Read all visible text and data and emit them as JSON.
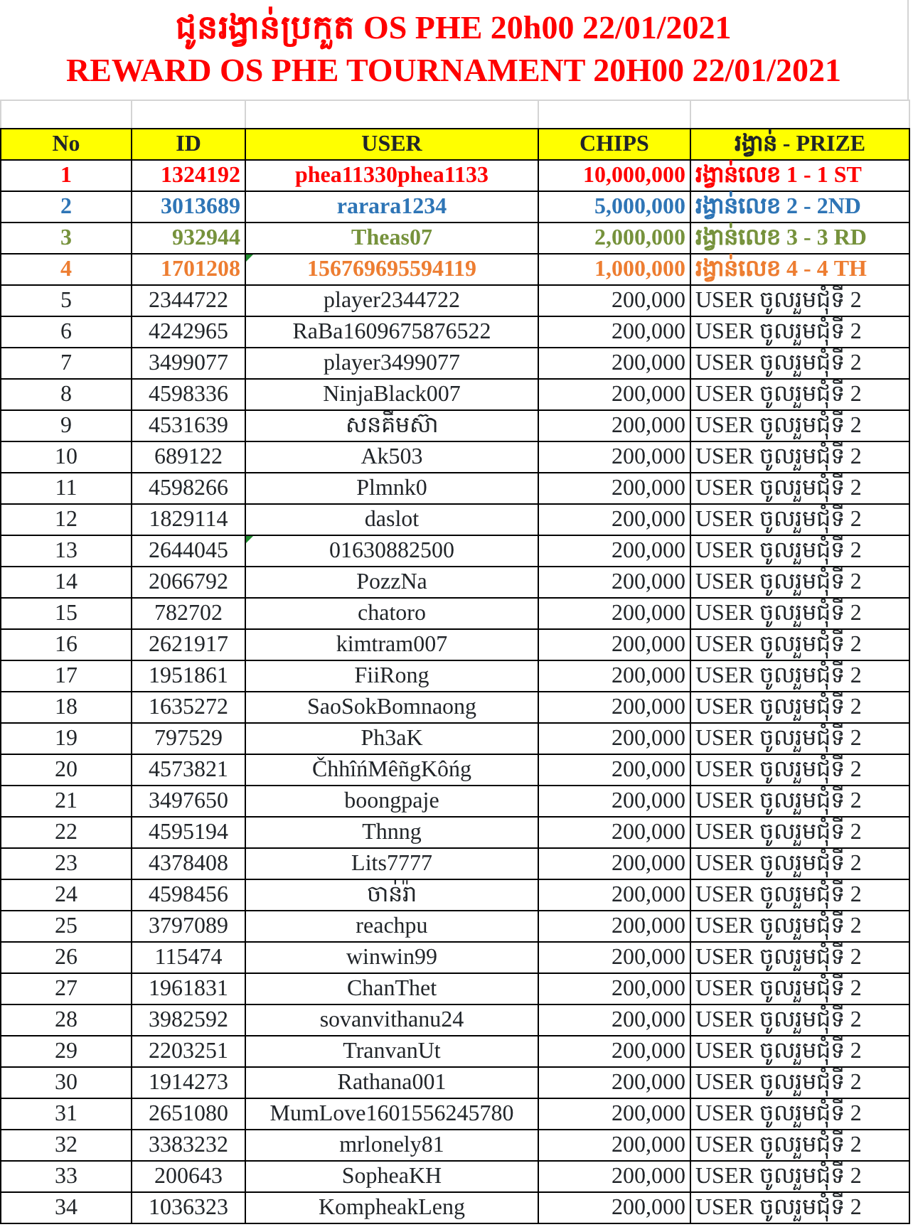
{
  "title_lines": [
    "ជូនរង្វាន់ប្រកួត OS PHE 20h00 22/01/2021",
    "REWARD OS PHE TOURNAMENT 20H00 22/01/2021"
  ],
  "table": {
    "columns": [
      "No",
      "ID",
      "USER",
      "CHIPS",
      "រង្វាន់ - PRIZE"
    ],
    "rows": [
      {
        "no": "1",
        "id": "1324192",
        "user": "phea11330phea1133",
        "chips": "10,000,000",
        "prize": "រង្វាន់លេខ 1 - 1 ST",
        "kind": "winner",
        "color": "#ff0000",
        "flagged": false
      },
      {
        "no": "2",
        "id": "3013689",
        "user": "rarara1234",
        "chips": "5,000,000",
        "prize": "រង្វាន់លេខ 2 - 2ND",
        "kind": "winner",
        "color": "#2e75b6",
        "flagged": false
      },
      {
        "no": "3",
        "id": "932944",
        "user": "Theas07",
        "chips": "2,000,000",
        "prize": "រង្វាន់លេខ 3 - 3 RD",
        "kind": "winner",
        "color": "#76923c",
        "flagged": false
      },
      {
        "no": "4",
        "id": "1701208",
        "user": "156769695594119",
        "chips": "1,000,000",
        "prize": "រង្វាន់លេខ 4 - 4 TH",
        "kind": "winner",
        "color": "#ed7d31",
        "flagged": true
      },
      {
        "no": "5",
        "id": "2344722",
        "user": "player2344722",
        "chips": "200,000",
        "prize": "USER ចូលរួមជុំទី 2",
        "kind": "entry",
        "flagged": false
      },
      {
        "no": "6",
        "id": "4242965",
        "user": "RaBa1609675876522",
        "chips": "200,000",
        "prize": "USER ចូលរួមជុំទី 2",
        "kind": "entry",
        "flagged": false
      },
      {
        "no": "7",
        "id": "3499077",
        "user": "player3499077",
        "chips": "200,000",
        "prize": "USER ចូលរួមជុំទី 2",
        "kind": "entry",
        "flagged": false
      },
      {
        "no": "8",
        "id": "4598336",
        "user": "NinjaBlack007",
        "chips": "200,000",
        "prize": "USER ចូលរួមជុំទី 2",
        "kind": "entry",
        "flagged": false
      },
      {
        "no": "9",
        "id": "4531639",
        "user": "សនគឹមស៊ា",
        "chips": "200,000",
        "prize": "USER ចូលរួមជុំទី 2",
        "kind": "entry",
        "flagged": false
      },
      {
        "no": "10",
        "id": "689122",
        "user": "Ak503",
        "chips": "200,000",
        "prize": "USER ចូលរួមជុំទី 2",
        "kind": "entry",
        "flagged": false
      },
      {
        "no": "11",
        "id": "4598266",
        "user": "Plmnk0",
        "chips": "200,000",
        "prize": "USER ចូលរួមជុំទី 2",
        "kind": "entry",
        "flagged": false
      },
      {
        "no": "12",
        "id": "1829114",
        "user": "daslot",
        "chips": "200,000",
        "prize": "USER ចូលរួមជុំទី 2",
        "kind": "entry",
        "flagged": false
      },
      {
        "no": "13",
        "id": "2644045",
        "user": "01630882500",
        "chips": "200,000",
        "prize": "USER ចូលរួមជុំទី 2",
        "kind": "entry",
        "flagged": true
      },
      {
        "no": "14",
        "id": "2066792",
        "user": "PozzNa",
        "chips": "200,000",
        "prize": "USER ចូលរួមជុំទី 2",
        "kind": "entry",
        "flagged": false
      },
      {
        "no": "15",
        "id": "782702",
        "user": "chatoro",
        "chips": "200,000",
        "prize": "USER ចូលរួមជុំទី 2",
        "kind": "entry",
        "flagged": false
      },
      {
        "no": "16",
        "id": "2621917",
        "user": "kimtram007",
        "chips": "200,000",
        "prize": "USER ចូលរួមជុំទី 2",
        "kind": "entry",
        "flagged": false
      },
      {
        "no": "17",
        "id": "1951861",
        "user": "FiiRong",
        "chips": "200,000",
        "prize": "USER ចូលរួមជុំទី 2",
        "kind": "entry",
        "flagged": false
      },
      {
        "no": "18",
        "id": "1635272",
        "user": "SaoSokBomnaong",
        "chips": "200,000",
        "prize": "USER ចូលរួមជុំទី 2",
        "kind": "entry",
        "flagged": false
      },
      {
        "no": "19",
        "id": "797529",
        "user": "Ph3aK",
        "chips": "200,000",
        "prize": "USER ចូលរួមជុំទី 2",
        "kind": "entry",
        "flagged": false
      },
      {
        "no": "20",
        "id": "4573821",
        "user": "ČhhîńMêñgKôńg",
        "chips": "200,000",
        "prize": "USER ចូលរួមជុំទី 2",
        "kind": "entry",
        "flagged": false
      },
      {
        "no": "21",
        "id": "3497650",
        "user": "boongpaje",
        "chips": "200,000",
        "prize": "USER ចូលរួមជុំទី 2",
        "kind": "entry",
        "flagged": false
      },
      {
        "no": "22",
        "id": "4595194",
        "user": "Thnng",
        "chips": "200,000",
        "prize": "USER ចូលរួមជុំទី 2",
        "kind": "entry",
        "flagged": false
      },
      {
        "no": "23",
        "id": "4378408",
        "user": "Lits7777",
        "chips": "200,000",
        "prize": "USER ចូលរួមជុំទី 2",
        "kind": "entry",
        "flagged": false
      },
      {
        "no": "24",
        "id": "4598456",
        "user": "ចាន់រ៉ា",
        "chips": "200,000",
        "prize": "USER ចូលរួមជុំទី 2",
        "kind": "entry",
        "flagged": false
      },
      {
        "no": "25",
        "id": "3797089",
        "user": "reachpu",
        "chips": "200,000",
        "prize": "USER ចូលរួមជុំទី 2",
        "kind": "entry",
        "flagged": false
      },
      {
        "no": "26",
        "id": "115474",
        "user": "winwin99",
        "chips": "200,000",
        "prize": "USER ចូលរួមជុំទី 2",
        "kind": "entry",
        "flagged": false
      },
      {
        "no": "27",
        "id": "1961831",
        "user": "ChanThet",
        "chips": "200,000",
        "prize": "USER ចូលរួមជុំទី 2",
        "kind": "entry",
        "flagged": false
      },
      {
        "no": "28",
        "id": "3982592",
        "user": "sovanvithanu24",
        "chips": "200,000",
        "prize": "USER ចូលរួមជុំទី 2",
        "kind": "entry",
        "flagged": false
      },
      {
        "no": "29",
        "id": "2203251",
        "user": "TranvanUt",
        "chips": "200,000",
        "prize": "USER ចូលរួមជុំទី 2",
        "kind": "entry",
        "flagged": false
      },
      {
        "no": "30",
        "id": "1914273",
        "user": "Rathana001",
        "chips": "200,000",
        "prize": "USER ចូលរួមជុំទី 2",
        "kind": "entry",
        "flagged": false
      },
      {
        "no": "31",
        "id": "2651080",
        "user": "MumLove1601556245780",
        "chips": "200,000",
        "prize": "USER ចូលរួមជុំទី 2",
        "kind": "entry",
        "flagged": false
      },
      {
        "no": "32",
        "id": "3383232",
        "user": "mrlonely81",
        "chips": "200,000",
        "prize": "USER ចូលរួមជុំទី 2",
        "kind": "entry",
        "flagged": false
      },
      {
        "no": "33",
        "id": "200643",
        "user": "SopheaKH",
        "chips": "200,000",
        "prize": "USER ចូលរួមជុំទី 2",
        "kind": "entry",
        "flagged": false
      },
      {
        "no": "34",
        "id": "1036323",
        "user": "KompheakLeng",
        "chips": "200,000",
        "prize": "USER ចូលរួមជុំទី 2",
        "kind": "entry",
        "flagged": false
      }
    ]
  }
}
